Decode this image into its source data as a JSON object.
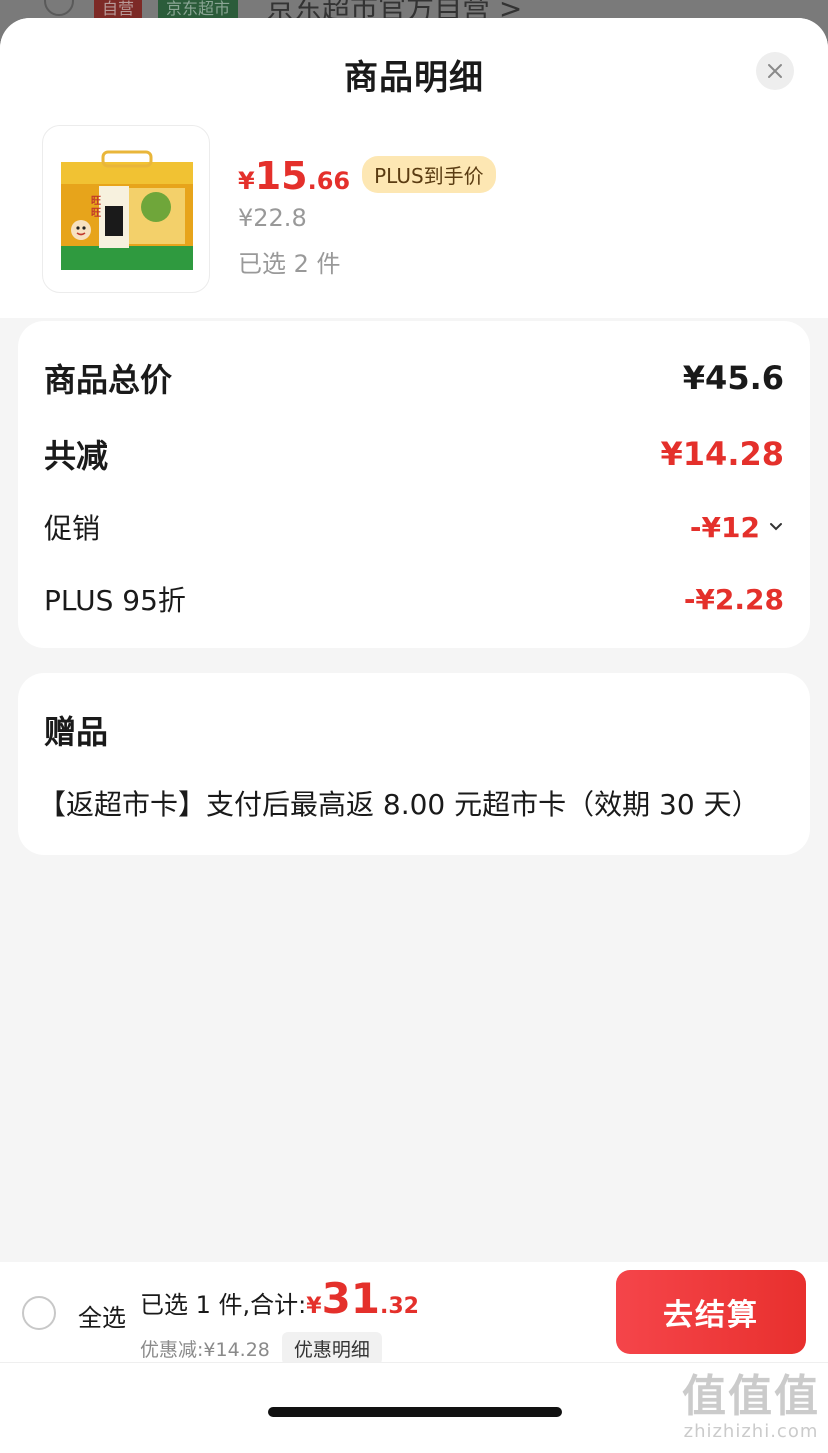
{
  "background_page": {
    "tag_self": "自营",
    "tag_store": "京东超市",
    "shop_name": "京东超市官方自营 >"
  },
  "sheet": {
    "title": "商品明细",
    "close_icon": "close-icon"
  },
  "product": {
    "price_yen": "¥",
    "price_int": "15",
    "price_dec": ".66",
    "plus_tag": "PLUS到手价",
    "original_price": "¥22.8",
    "selected_count": "已选 2 件",
    "image_text": "旺旺 仙贝"
  },
  "summary": {
    "total_label": "商品总价",
    "total_value": "¥45.6",
    "reduction_label": "共减",
    "reduction_value": "¥14.28",
    "promo_label": "促销",
    "promo_value": "-¥12",
    "plus_label": "PLUS 95折",
    "plus_value": "-¥2.28"
  },
  "gift": {
    "title": "赠品",
    "text": "【返超市卡】支付后最高返 8.00 元超市卡（效期 30 天）"
  },
  "bottom_bar": {
    "select_all": "全选",
    "total_prefix": "已选 1 件,合计:",
    "total_yen": "¥",
    "total_int": "31",
    "total_dec": ".32",
    "discount_text": "优惠减:¥14.28",
    "discount_detail": "优惠明细",
    "checkout": "去结算"
  },
  "watermark": {
    "big": "值值值",
    "small": "zhizhizhi.com"
  },
  "colors": {
    "accent_red": "#e4302b",
    "plus_tag_bg": "#fde7b3"
  }
}
